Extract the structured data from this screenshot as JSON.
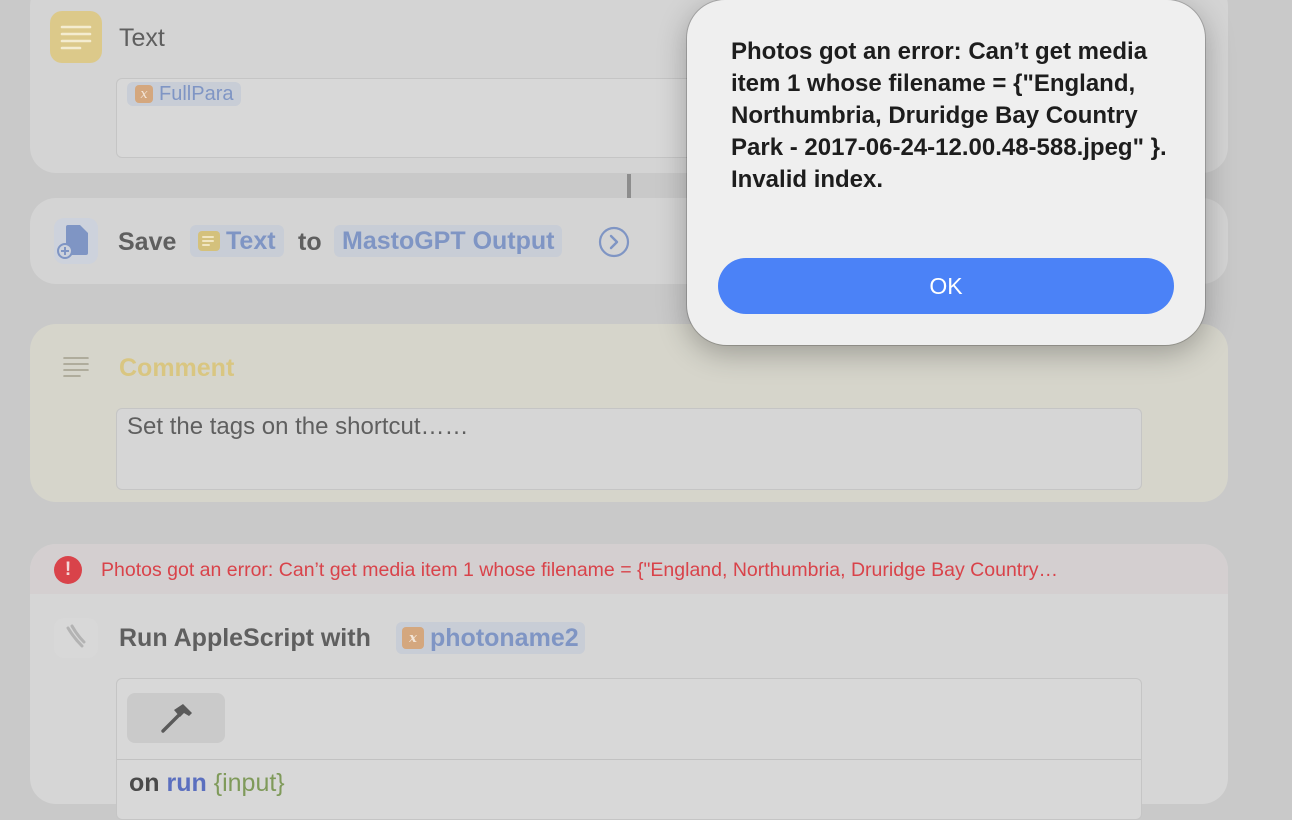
{
  "text_action": {
    "title": "Text",
    "variable": "FullPara"
  },
  "save_action": {
    "verb": "Save",
    "input_token": "Text",
    "connector": "to",
    "destination": "MastoGPT Output"
  },
  "comment_action": {
    "title": "Comment",
    "body": "Set the tags on the shortcut……"
  },
  "applescript_action": {
    "error_banner": "Photos got an error: Can’t get media item 1 whose filename = {\"England, Northumbria, Druridge Bay Country…",
    "title": "Run AppleScript with",
    "variable": "photoname2",
    "code_keyword": "on",
    "code_handler": "run",
    "code_param": "{input}"
  },
  "dialog": {
    "message": "Photos got an error: Can’t get media item 1 whose filename = {\"England, Northumbria, Druridge Bay Country Park - 2017-06-24-12.00.48-588.jpeg\" }. Invalid index.",
    "ok_label": "OK"
  },
  "colors": {
    "accent_blue": "#4b82f7",
    "error_red": "#d9434a",
    "comment_yellow": "#e2cd82",
    "token_blue": "#7f95c4"
  },
  "icons": {
    "text_action": "text-lines-icon",
    "save_action": "document-add-icon",
    "comment_action": "comment-lines-icon",
    "error": "exclamation-circle-icon",
    "applescript": "applescript-icon",
    "disclosure": "chevron-right-circle-icon",
    "compile": "hammer-icon"
  }
}
